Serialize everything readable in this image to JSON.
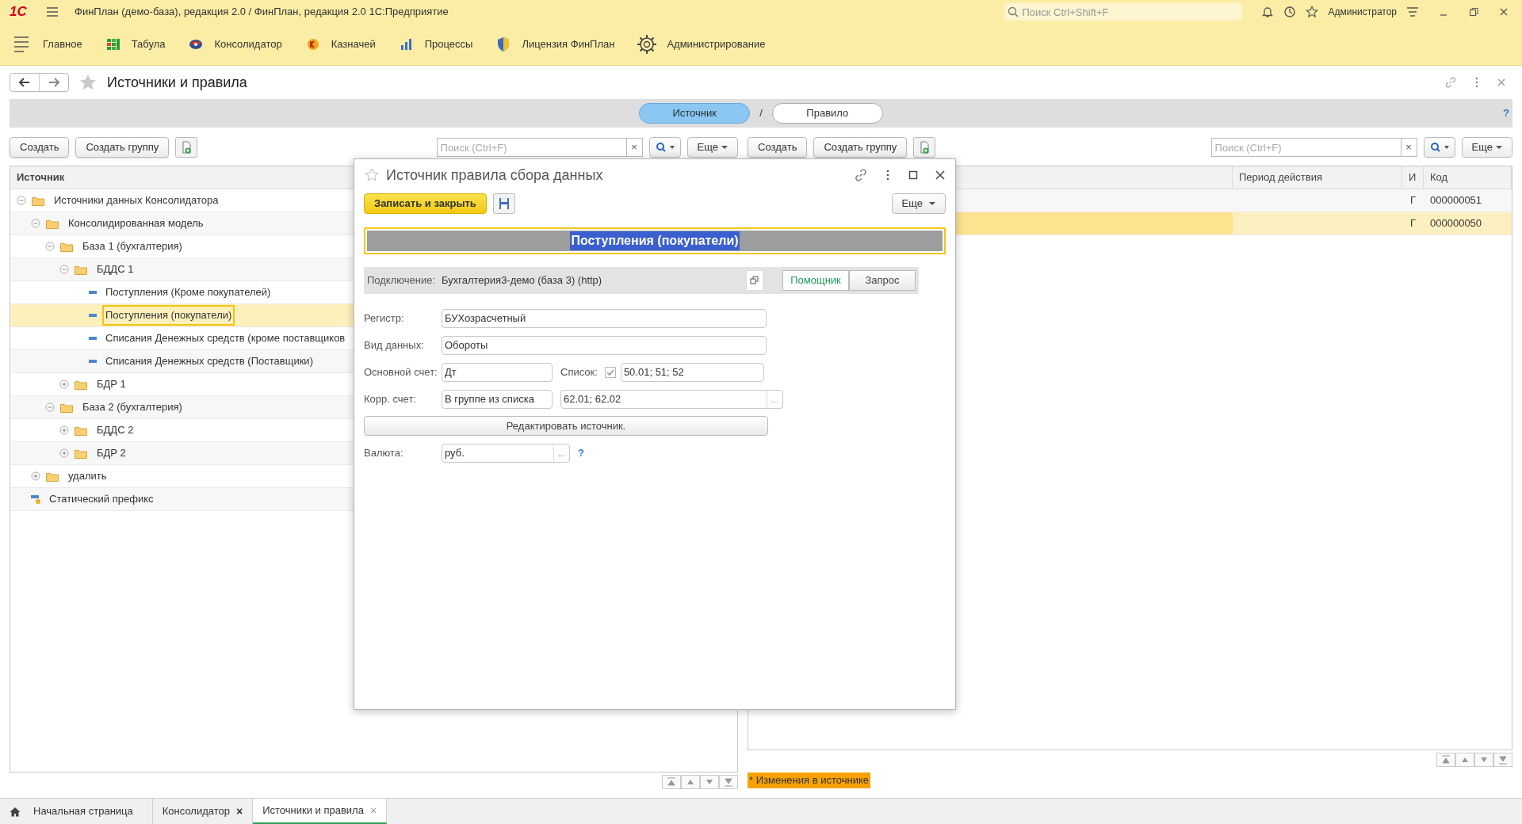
{
  "app_bar": {
    "logo": "1С",
    "title": "ФинПлан (демо-база), редакция 2.0 / ФинПлан, редакция 2.0 1С:Предприятие",
    "search": {
      "placeholder": "Поиск Ctrl+Shift+F"
    },
    "user": "Администратор"
  },
  "sections": [
    {
      "label": "Главное",
      "kind": "home"
    },
    {
      "label": "Табула",
      "kind": "grid"
    },
    {
      "label": "Консолидатор",
      "kind": "consolidator"
    },
    {
      "label": "Казначей",
      "kind": "treasurer"
    },
    {
      "label": "Процессы",
      "kind": "bars"
    },
    {
      "label": "Лицензия ФинПлан",
      "kind": "shield"
    },
    {
      "label": "Администрирование",
      "kind": "gear"
    }
  ],
  "page": {
    "title": "Источники и правила"
  },
  "mode_switch": {
    "options": [
      {
        "label": "Источник",
        "selected": true
      },
      {
        "label": "Правило",
        "selected": false
      }
    ],
    "separator": "/",
    "help": "?"
  },
  "left_panel": {
    "toolbar": {
      "create": "Создать",
      "create_group": "Создать группу",
      "search_placeholder": "Поиск (Ctrl+F)",
      "clear": "×",
      "more": "Еще"
    },
    "column": "Источник",
    "tree": [
      {
        "label": "Источники данных Консолидатора",
        "kind": "folder",
        "expanded": true,
        "selected": false,
        "children": [
          {
            "label": "Консолидированная модель",
            "kind": "folder",
            "expanded": true,
            "selected": false,
            "children": [
              {
                "label": "База 1 (бухгалтерия)",
                "kind": "folder",
                "expanded": true,
                "selected": false,
                "children": [
                  {
                    "label": "БДДС 1",
                    "kind": "folder",
                    "expanded": true,
                    "selected": false,
                    "children": [
                      {
                        "label": "Поступления (Кроме покупателей)",
                        "kind": "item",
                        "selected": false
                      },
                      {
                        "label": "Поступления (покупатели)",
                        "kind": "item",
                        "selected": true
                      },
                      {
                        "label": "Списания Денежных средств (кроме поставщиков",
                        "kind": "item",
                        "selected": false
                      },
                      {
                        "label": "Списания Денежных средств (Поставщики)",
                        "kind": "item",
                        "selected": false
                      }
                    ]
                  },
                  {
                    "label": "БДР 1",
                    "kind": "folder",
                    "expanded": false,
                    "selected": false
                  }
                ]
              },
              {
                "label": "База 2 (бухгалтерия)",
                "kind": "folder",
                "expanded": true,
                "selected": false,
                "children": [
                  {
                    "label": "БДДС 2",
                    "kind": "folder",
                    "expanded": false,
                    "selected": false
                  },
                  {
                    "label": "БДР 2",
                    "kind": "folder",
                    "expanded": false,
                    "selected": false
                  }
                ]
              }
            ]
          },
          {
            "label": "удалить",
            "kind": "folder",
            "expanded": false,
            "selected": false
          },
          {
            "label": "Статический префикс",
            "kind": "prefix",
            "selected": false
          }
        ]
      }
    ]
  },
  "right_panel": {
    "toolbar": {
      "create": "Создать",
      "create_group": "Создать группу",
      "search_placeholder": "Поиск (Ctrl+F)",
      "clear": "×",
      "more": "Еще"
    },
    "columns": [
      "Период действия",
      "И",
      "Код"
    ],
    "rows": [
      {
        "mark": "Г",
        "code": "000000051",
        "selected": false
      },
      {
        "mark": "Г",
        "code": "000000050",
        "selected": true
      }
    ]
  },
  "dialog": {
    "title": "Источник правила сбора данных",
    "save_close": "Записать и закрыть",
    "more": "Еще",
    "name": "Поступления (покупатели)",
    "connection": {
      "label": "Подключение:",
      "value": "Бухгалтерия3-демо (база 3) (http)",
      "modes": [
        {
          "label": "Помощник",
          "selected": true
        },
        {
          "label": "Запрос",
          "selected": false
        }
      ]
    },
    "register": {
      "label": "Регистр:",
      "value": "БУХозрасчетный"
    },
    "data_kind": {
      "label": "Вид данных:",
      "value": "Обороты"
    },
    "main_account": {
      "label": "Основной счет:",
      "value": "Дт",
      "list_label": "Список:",
      "list_checked": true,
      "list_value": "50.01; 51; 52"
    },
    "corr_account": {
      "label": "Корр. счет:",
      "value": "В группе из списка",
      "list_value": "62.01; 62.02",
      "pick": "..."
    },
    "edit_button": "Редактировать источник.",
    "currency": {
      "label": "Валюта:",
      "value": "руб.",
      "pick": "...",
      "help": "?"
    }
  },
  "status_note": "* Изменения в источнике",
  "open_tabs": [
    {
      "label": "Начальная страница",
      "kind": "home",
      "selected": false
    },
    {
      "label": "Консолидатор",
      "kind": "closable",
      "selected": false,
      "close": "×"
    },
    {
      "label": "Источники и правила",
      "kind": "closable",
      "selected": true,
      "close": "×"
    }
  ]
}
